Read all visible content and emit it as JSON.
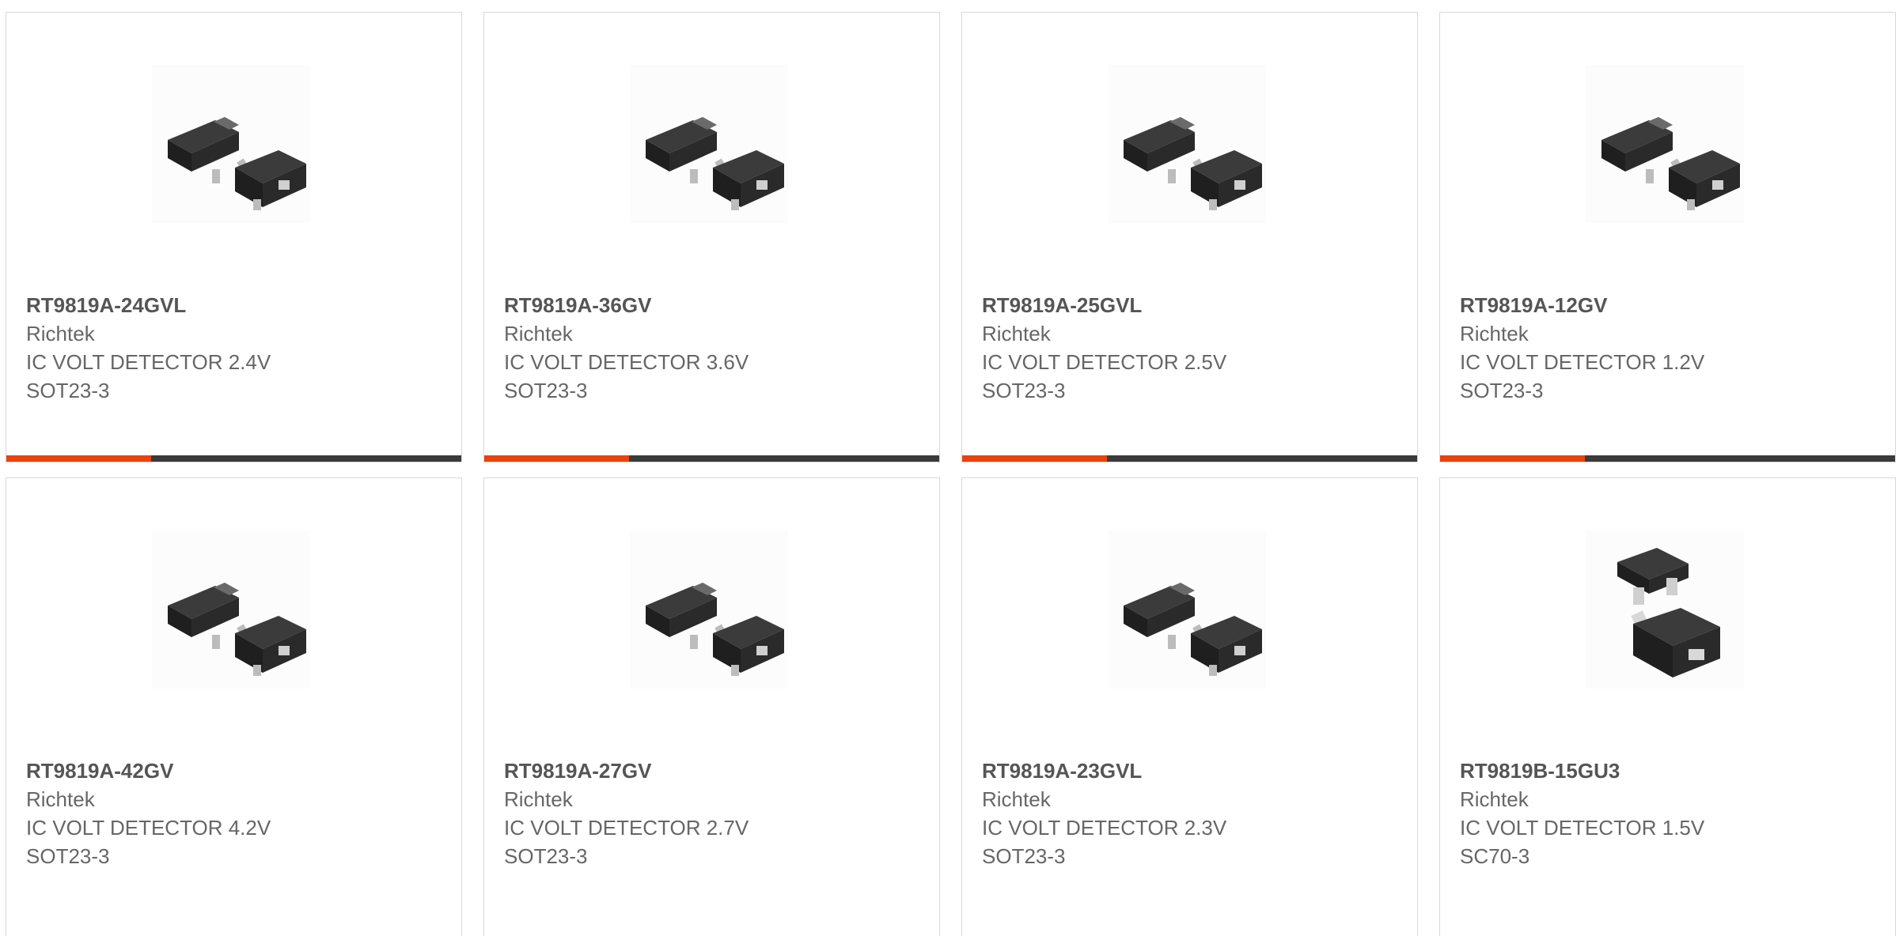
{
  "colors": {
    "accent": "#e8420f",
    "bar_dark": "#3a3a3a",
    "text": "#666666",
    "border": "#d9d9d9"
  },
  "cards": [
    {
      "part": "RT9819A-24GVL",
      "brand": "Richtek",
      "desc": "IC VOLT DETECTOR 2.4V",
      "package": "SOT23-3",
      "image": "sot23-3-package-image"
    },
    {
      "part": "RT9819A-36GV",
      "brand": "Richtek",
      "desc": "IC VOLT DETECTOR 3.6V",
      "package": "SOT23-3",
      "image": "sot23-3-package-image"
    },
    {
      "part": "RT9819A-25GVL",
      "brand": "Richtek",
      "desc": "IC VOLT DETECTOR 2.5V",
      "package": "SOT23-3",
      "image": "sot23-3-package-image"
    },
    {
      "part": "RT9819A-12GV",
      "brand": "Richtek",
      "desc": "IC VOLT DETECTOR 1.2V",
      "package": "SOT23-3",
      "image": "sot23-3-package-image"
    },
    {
      "part": "RT9819A-42GV",
      "brand": "Richtek",
      "desc": "IC VOLT DETECTOR 4.2V",
      "package": "SOT23-3",
      "image": "sot23-3-package-image"
    },
    {
      "part": "RT9819A-27GV",
      "brand": "Richtek",
      "desc": "IC VOLT DETECTOR 2.7V",
      "package": "SOT23-3",
      "image": "sot23-3-package-image"
    },
    {
      "part": "RT9819A-23GVL",
      "brand": "Richtek",
      "desc": "IC VOLT DETECTOR 2.3V",
      "package": "SOT23-3",
      "image": "sot23-3-package-image"
    },
    {
      "part": "RT9819B-15GU3",
      "brand": "Richtek",
      "desc": "IC VOLT DETECTOR 1.5V",
      "package": "SC70-3",
      "image": "sc70-3-package-image"
    }
  ]
}
